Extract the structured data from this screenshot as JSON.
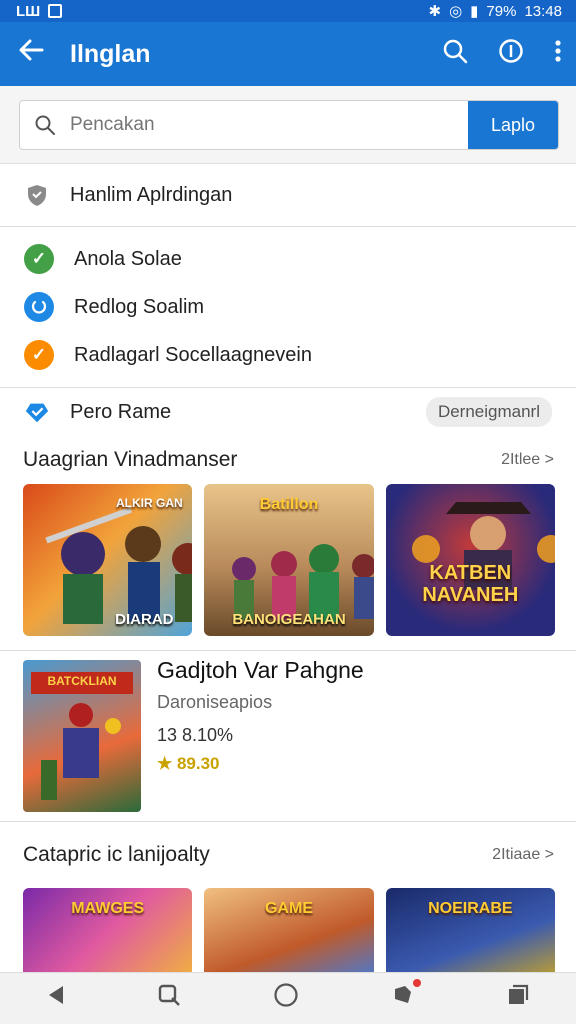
{
  "status": {
    "left": "LШ",
    "battery": "79%",
    "time": "13:48"
  },
  "appbar": {
    "title": "Ilnglan"
  },
  "search": {
    "placeholder": "Pencakan",
    "button": "Laplo"
  },
  "menu": {
    "header_item": "Hanlim Aplrdingan",
    "items": [
      {
        "label": "Anola Solae",
        "color": "#43a047"
      },
      {
        "label": "Redlog Soalim",
        "color": "#1e88e5"
      },
      {
        "label": "Radlagarl Socellaagnevein",
        "color": "#fb8c00"
      }
    ],
    "pero": {
      "label": "Pero Rame",
      "badge": "Derneigmanrl"
    }
  },
  "section1": {
    "title": "Uaagrian Vinadmanser",
    "more": "2Itlee >",
    "tiles": [
      {
        "top": "ALKIR GAN",
        "caption": "DIARAD",
        "colors": [
          "#d94a1a",
          "#f2a33a",
          "#4fa3d9"
        ]
      },
      {
        "top": "Batillon",
        "caption": "BANOIGEAHAN",
        "colors": [
          "#b88a5a",
          "#e8c48a",
          "#5a8a4a"
        ]
      },
      {
        "big": "KATBEN NAVANEH",
        "caption": "",
        "colors": [
          "#2a2a7a",
          "#c03a3a",
          "#f0a020"
        ]
      }
    ]
  },
  "feature": {
    "name": "Gadjtoh Var Pahgne",
    "sub": "Daroniseapios",
    "pct": "13 8.10%",
    "price": "★ 89.30",
    "art_title": "BATCKLIAN"
  },
  "section2": {
    "title": "Catapric ic lanijoalty",
    "more": "2Itiaae >",
    "tiles": [
      {
        "top": "MAWGES",
        "colors": [
          "#7a2aa8",
          "#e05aa0",
          "#f0b040"
        ]
      },
      {
        "top": "GAME",
        "colors": [
          "#c05a2a",
          "#f0c080",
          "#4a7ad0"
        ]
      },
      {
        "top": "NOEIRABE",
        "colors": [
          "#1a2a6a",
          "#3a5ab0",
          "#c0a030"
        ]
      }
    ]
  }
}
